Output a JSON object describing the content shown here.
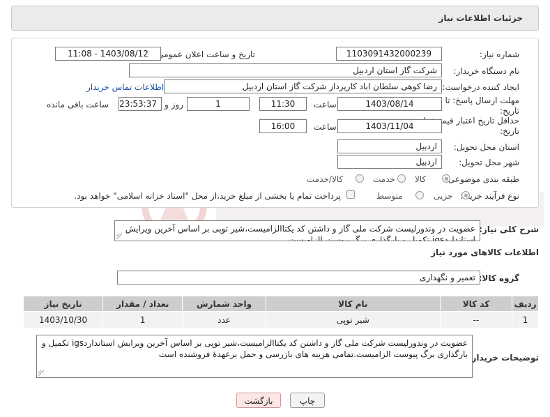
{
  "header": {
    "title": "جزئیات اطلاعات نیاز"
  },
  "form": {
    "need_number": {
      "label": "شماره نیاز:",
      "value": "1103091432000239"
    },
    "announce_datetime": {
      "label": "تاریخ و ساعت اعلان عمومی:",
      "value": "1403/08/12 - 11:08"
    },
    "buyer_org": {
      "label": "نام دستگاه خریدار:",
      "value": "شرکت گاز استان اردبیل"
    },
    "requester": {
      "label": "ایجاد کننده درخواست:",
      "value": "رضا کوهی سلطان اباد کارپرداز شرکت گاز استان اردبیل",
      "contact_link": "اطلاعات تماس خریدار"
    },
    "reply_deadline": {
      "label_line1": "مهلت ارسال پاسخ: تا",
      "label_line2": "تاریخ:",
      "date": "1403/08/14",
      "time_label": "ساعت",
      "time": "11:30",
      "days": "1",
      "days_label": "روز و",
      "remaining": "23:53:37",
      "remaining_label": "ساعت باقی مانده"
    },
    "price_validity": {
      "label_line1": "حداقل تاریخ اعتبار قیمت: تا",
      "label_line2": "تاریخ:",
      "date": "1403/11/04",
      "time_label": "ساعت",
      "time": "16:00"
    },
    "delivery_province": {
      "label": "استان محل تحویل:",
      "value": "اردبیل"
    },
    "delivery_city": {
      "label": "شهر محل تحویل:",
      "value": "اردبیل"
    },
    "category": {
      "label": "طبقه بندی موضوعی:",
      "options": [
        "کالا",
        "خدمت",
        "کالا/خدمت"
      ],
      "selected": "کالا"
    },
    "purchase_process": {
      "label": "نوع فرآیند خرید :",
      "options": [
        "جزیی",
        "متوسط"
      ],
      "selected": "جزیی",
      "payment_note": "پرداخت تمام یا بخشی از مبلغ خرید،از محل \"اسناد خزانه اسلامی\" خواهد بود."
    }
  },
  "summary": {
    "label": "شرح کلی نیاز:",
    "text": "عضویت در وندورلیست شرکت ملی گاز و داشتن کد یکتاالزامیست،شیر توپی بر اساس آخرین ویرایش استانداردigs تکمیل و بارگذاری برگ پیوست الزامیست."
  },
  "goods": {
    "section_title": "اطلاعات کالاهای مورد نیاز",
    "group_label": "گروه کالا:",
    "group_value": "تعمیر و نگهداری",
    "table": {
      "columns": [
        "ردیف",
        "کد کالا",
        "نام کالا",
        "واحد شمارش",
        "تعداد / مقدار",
        "تاریخ نیاز"
      ],
      "rows": [
        [
          "1",
          "--",
          "شیر توپی",
          "عدد",
          "1",
          "1403/10/30"
        ]
      ]
    }
  },
  "buyer_notes": {
    "label": "توضیحات خریدار:",
    "text": "عضویت در وندورلیست شرکت ملی گاز و داشتن کد یکتاالزامیست،شیر توپی بر اساس آخرین ویرایش استانداردigs تکمیل و بارگذاری برگ پیوست الزامیست.تمامی هزینه های بازرسی و حمل برعهدۀ فروشنده است"
  },
  "buttons": {
    "print": "چاپ",
    "back": "بازگشت"
  },
  "colors": {
    "header_bg": "#ebebeb",
    "table_header_bg": "#cdcdcd",
    "link": "#1a4fa6",
    "back_button_bg": "#fbe6e6"
  }
}
